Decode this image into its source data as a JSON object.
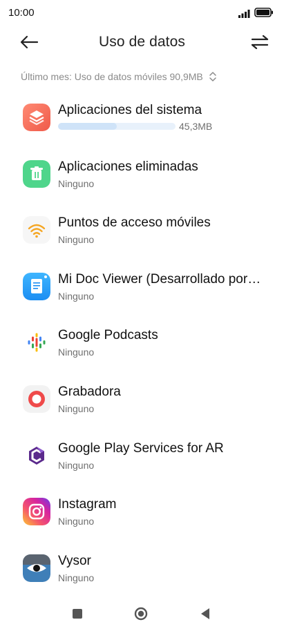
{
  "status_bar": {
    "time": "10:00"
  },
  "header": {
    "title": "Uso de datos"
  },
  "filter": {
    "label": "Último mes: Uso de datos móviles 90,9MB"
  },
  "apps": [
    {
      "name": "Aplicaciones del sistema",
      "usage": "45,3MB",
      "usage_fraction": 0.5,
      "icon": "layers-icon"
    },
    {
      "name": "Aplicaciones eliminadas",
      "sub": "Ninguno",
      "icon": "trash-icon"
    },
    {
      "name": "Puntos de acceso móviles",
      "sub": "Ninguno",
      "icon": "wifi-hotspot-icon"
    },
    {
      "name": "Mi Doc Viewer (Desarrollado por…",
      "sub": "Ninguno",
      "icon": "document-icon"
    },
    {
      "name": "Google Podcasts",
      "sub": "Ninguno",
      "icon": "podcasts-icon"
    },
    {
      "name": "Grabadora",
      "sub": "Ninguno",
      "icon": "recorder-icon"
    },
    {
      "name": "Google Play Services for AR",
      "sub": "Ninguno",
      "icon": "ar-services-icon"
    },
    {
      "name": "Instagram",
      "sub": "Ninguno",
      "icon": "instagram-icon"
    },
    {
      "name": "Vysor",
      "sub": "Ninguno",
      "icon": "vysor-icon"
    }
  ],
  "colors": {
    "usage_bar": "#cfe3f8",
    "usage_track": "#e8f1fb"
  }
}
